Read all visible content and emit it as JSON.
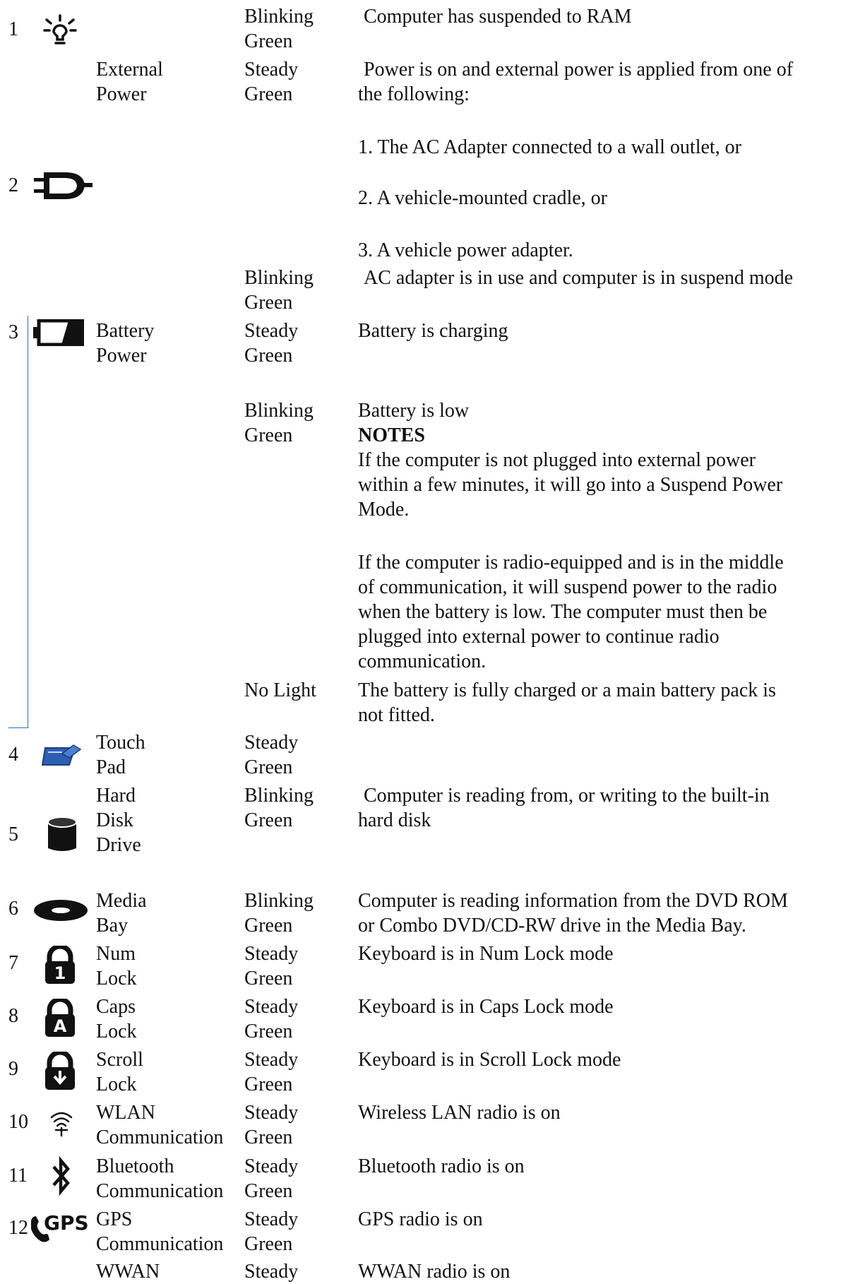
{
  "rows": [
    {
      "number": "",
      "icon": "lightbulb-icon",
      "label": [
        "",
        ""
      ],
      "states": [
        {
          "text": [
            "Blinking",
            "Green"
          ],
          "description": [
            "Computer has suspended to RAM"
          ]
        }
      ]
    },
    {
      "number": "",
      "icon": "plug-icon",
      "label": [
        "External",
        "Power"
      ],
      "states": [
        {
          "text": [
            "Steady",
            "Green"
          ],
          "description": [
            "Power is on and external power is applied from one of",
            "the following:",
            "1. The  AC Adapter connected to a wall outlet, or",
            "2. A vehicle-mounted cradle, or",
            "3. A vehicle power adapter."
          ]
        },
        {
          "text": [
            "Blinking",
            "Green"
          ],
          "description": [
            "AC adapter is in use and computer is in suspend mode"
          ]
        }
      ]
    },
    {
      "number": "",
      "icon": "battery-icon",
      "label": [
        "Battery",
        "Power"
      ],
      "states": [
        {
          "text": [
            "Steady",
            "Green"
          ],
          "description": [
            "Battery is charging"
          ]
        },
        {
          "text": [
            "Blinking",
            "Green"
          ],
          "description": [
            "Battery is low"
          ],
          "notes_heading": "NOTES",
          "notes": [
            "If the computer is not plugged into external power",
            "within a few minutes, it will go into a Suspend Power",
            "Mode.",
            "If the computer is radio-equipped and is in the middle",
            "of communication, it will suspend power to the radio",
            "when the battery is low.  The computer must then be",
            "plugged into external power to continue radio",
            "communication."
          ]
        },
        {
          "text": [
            "No Light"
          ],
          "description": [
            "The battery is fully charged or a main battery pack is",
            "not fitted."
          ]
        }
      ]
    },
    {
      "number": "",
      "icon": "touchpad-icon",
      "label": [
        "Touch",
        "Pad"
      ],
      "states": [
        {
          "text": [
            "Steady",
            "Green"
          ],
          "description": []
        }
      ]
    },
    {
      "number": "",
      "icon": "hard-disk-icon",
      "label": [
        "Hard",
        "Disk",
        "Drive"
      ],
      "states": [
        {
          "text": [
            "Blinking",
            "Green"
          ],
          "description": [
            "Computer is reading from, or writing to the built-in",
            "hard disk"
          ]
        }
      ]
    },
    {
      "number": "",
      "icon": "media-bay-icon",
      "label": [
        "Media",
        "Bay"
      ],
      "states": [
        {
          "text": [
            "Blinking",
            "Green"
          ],
          "description": [
            "Computer is reading information from the DVD ROM",
            "or Combo DVD/CD-RW drive in the Media Bay."
          ]
        }
      ]
    },
    {
      "number": "",
      "icon": "num-lock-icon",
      "label": [
        "Num",
        "Lock"
      ],
      "states": [
        {
          "text": [
            "Steady",
            "Green"
          ],
          "description": [
            "Keyboard is in Num Lock  mode"
          ]
        }
      ]
    },
    {
      "number": "",
      "icon": "caps-lock-icon",
      "label": [
        "Caps",
        "Lock"
      ],
      "states": [
        {
          "text": [
            "Steady",
            "Green"
          ],
          "description": [
            "Keyboard is in Caps Lock mode"
          ]
        }
      ]
    },
    {
      "number": "",
      "icon": "scroll-lock-icon",
      "label": [
        "Scroll",
        "Lock"
      ],
      "states": [
        {
          "text": [
            "Steady",
            "Green"
          ],
          "description": [
            "Keyboard is in Scroll Lock mode"
          ]
        }
      ]
    },
    {
      "number": "",
      "icon": "wlan-icon",
      "label": [
        "WLAN",
        "Communication"
      ],
      "states": [
        {
          "text": [
            "Steady",
            "Green"
          ],
          "description": [
            "Wireless LAN radio is on"
          ]
        }
      ]
    },
    {
      "number": "",
      "icon": "bluetooth-icon",
      "label": [
        "Bluetooth",
        "Communication"
      ],
      "states": [
        {
          "text": [
            "Steady",
            "Green"
          ],
          "description": [
            "Bluetooth radio is on"
          ]
        }
      ]
    },
    {
      "number": "",
      "icon": "gps-icon",
      "label": [
        "GPS",
        "Communication"
      ],
      "states": [
        {
          "text": [
            "Steady",
            "Green"
          ],
          "description": [
            "GPS radio is on"
          ]
        }
      ]
    },
    {
      "number": "",
      "icon": "",
      "label": [
        "WWAN"
      ],
      "states": [
        {
          "text": [
            "Steady"
          ],
          "description": [
            "WWAN radio is on"
          ]
        }
      ]
    }
  ],
  "row_numbers": [
    "1",
    "2",
    "3",
    "4",
    "5",
    "6",
    "7",
    "8",
    "9",
    "10",
    "11",
    "12"
  ],
  "colors": {
    "text": "#111111",
    "bracket": "#2d6bb3",
    "touchpad_blue": "#2c5fb4"
  }
}
